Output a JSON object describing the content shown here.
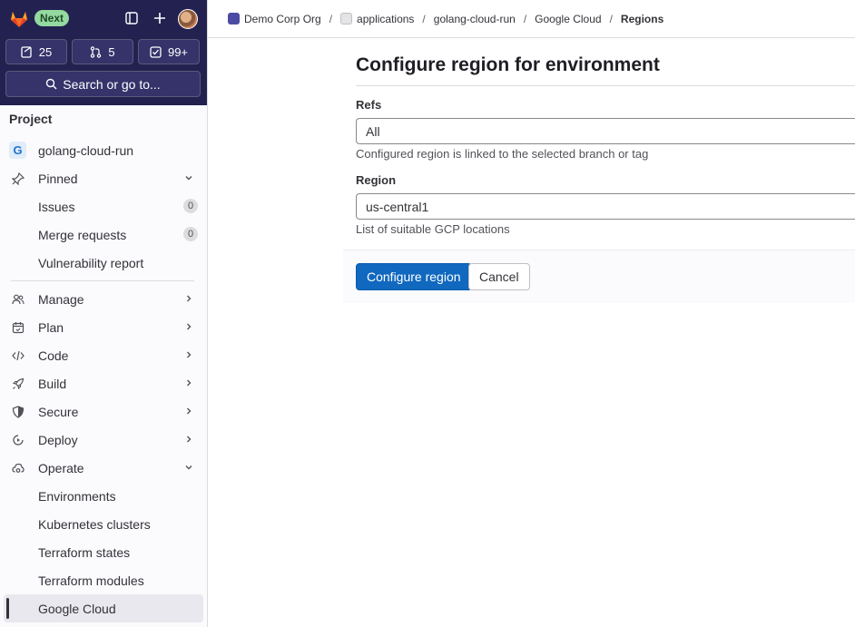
{
  "top": {
    "next_badge": "Next",
    "counts": [
      {
        "icon": "issues-icon",
        "value": "25"
      },
      {
        "icon": "merge-request-icon",
        "value": "5"
      },
      {
        "icon": "todo-icon",
        "value": "99+"
      }
    ],
    "search_label": "Search or go to..."
  },
  "sidebar": {
    "heading": "Project",
    "project_initial": "G",
    "project_name": "golang-cloud-run",
    "pinned": "Pinned",
    "pinned_items": [
      {
        "label": "Issues",
        "badge": "0"
      },
      {
        "label": "Merge requests",
        "badge": "0"
      },
      {
        "label": "Vulnerability report"
      }
    ],
    "sections": [
      {
        "label": "Manage",
        "icon": "users-icon"
      },
      {
        "label": "Plan",
        "icon": "calendar-icon"
      },
      {
        "label": "Code",
        "icon": "code-icon"
      },
      {
        "label": "Build",
        "icon": "rocket-icon"
      },
      {
        "label": "Secure",
        "icon": "shield-icon"
      },
      {
        "label": "Deploy",
        "icon": "deploy-icon"
      },
      {
        "label": "Operate",
        "icon": "cloud-gear-icon"
      }
    ],
    "operate_items": [
      {
        "label": "Environments"
      },
      {
        "label": "Kubernetes clusters"
      },
      {
        "label": "Terraform states"
      },
      {
        "label": "Terraform modules"
      },
      {
        "label": "Google Cloud"
      }
    ]
  },
  "breadcrumb": [
    "Demo Corp Org",
    "applications",
    "golang-cloud-run",
    "Google Cloud",
    "Regions"
  ],
  "form": {
    "title": "Configure region for environment",
    "refs_label": "Refs",
    "refs_value": "All",
    "refs_help": "Configured region is linked to the selected branch or tag",
    "region_label": "Region",
    "region_value": "us-central1",
    "region_help": "List of suitable GCP locations",
    "submit_label": "Configure region",
    "cancel_label": "Cancel"
  },
  "colors": {
    "sidebar_top": "#232150",
    "primary": "#1068bf",
    "next_badge": "#93d9a0"
  }
}
